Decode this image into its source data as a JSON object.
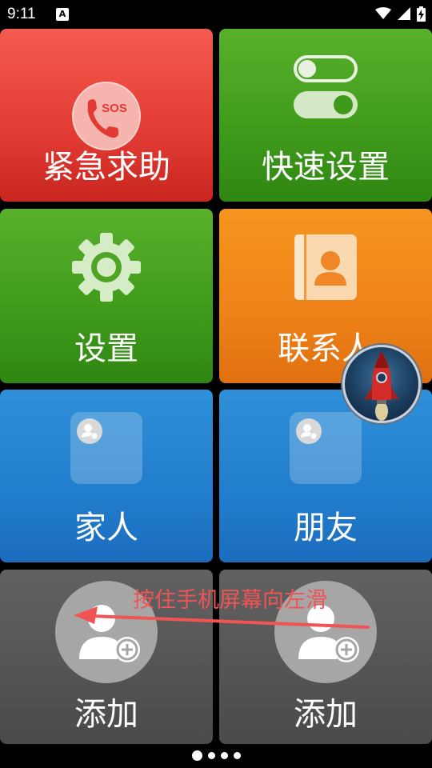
{
  "status_bar": {
    "time": "9:11",
    "notification_icon": "a-icon",
    "icons": [
      "wifi-icon",
      "signal-icon",
      "battery-charging-icon"
    ]
  },
  "tiles": {
    "sos": {
      "label": "紧急求助",
      "icon": "sos-phone-icon",
      "icon_text": "SOS",
      "color": "#e23b34"
    },
    "quick_settings": {
      "label": "快速设置",
      "icon": "toggle-switches-icon",
      "color": "#3f9a1b"
    },
    "settings": {
      "label": "设置",
      "icon": "gear-icon",
      "color": "#3f9a1b"
    },
    "contacts": {
      "label": "联系人",
      "icon": "contacts-book-icon",
      "color": "#ee8219"
    },
    "family": {
      "label": "家人",
      "icon": "folder-icon",
      "color": "#217dcd"
    },
    "friends": {
      "label": "朋友",
      "icon": "folder-icon",
      "color": "#217dcd"
    },
    "add_left": {
      "label": "添加",
      "icon": "add-contact-icon",
      "color": "#545454"
    },
    "add_right": {
      "label": "添加",
      "icon": "add-contact-icon",
      "color": "#545454"
    }
  },
  "swipe_hint": {
    "text": "按住手机屏幕向左滑",
    "color": "#f05454"
  },
  "floating_button": {
    "icon": "rocket-icon"
  },
  "page_indicator": {
    "count": 4,
    "active_index": 0
  }
}
